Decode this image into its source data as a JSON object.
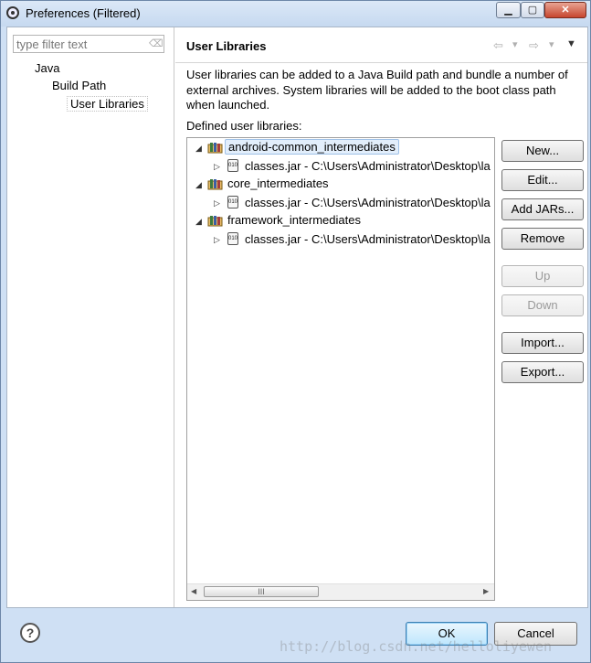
{
  "window": {
    "title": "Preferences (Filtered)",
    "min_glyph": "▁",
    "max_glyph": "▢",
    "close_glyph": "✕"
  },
  "sidebar": {
    "filter_placeholder": "type filter text",
    "tree": [
      {
        "label": "Java"
      },
      {
        "label": "Build Path"
      },
      {
        "label": "User Libraries",
        "selected": true
      }
    ]
  },
  "page": {
    "title": "User Libraries",
    "nav": {
      "back": "⇦",
      "back_menu": "▾",
      "forward": "⇨",
      "forward_menu": "▾",
      "menu": "▼"
    },
    "description": "User libraries can be added to a Java Build path and bundle a number of external archives. System libraries will be added to the boot class path when launched.",
    "defined_label": "Defined user libraries:"
  },
  "libraries": [
    {
      "name": "android-common_intermediates",
      "selected": true,
      "child": "classes.jar - C:\\Users\\Administrator\\Desktop\\la"
    },
    {
      "name": "core_intermediates",
      "child": "classes.jar - C:\\Users\\Administrator\\Desktop\\la"
    },
    {
      "name": "framework_intermediates",
      "child": "classes.jar - C:\\Users\\Administrator\\Desktop\\la"
    }
  ],
  "icons": {
    "expanded": "◢",
    "collapsed": "▷",
    "jar_text": "010"
  },
  "scrollbar": {
    "left": "◀",
    "right": "▶",
    "grip": "III"
  },
  "buttons": {
    "new": "New...",
    "edit": "Edit...",
    "add_jars": "Add JARs...",
    "remove": "Remove",
    "up": "Up",
    "down": "Down",
    "import": "Import...",
    "export": "Export..."
  },
  "footer": {
    "help": "?",
    "ok": "OK",
    "cancel": "Cancel"
  },
  "watermark": "http://blog.csdn.net/helloliyewen",
  "colors": {
    "selection": "#e2eefb",
    "default_button": "#bee6fd"
  }
}
